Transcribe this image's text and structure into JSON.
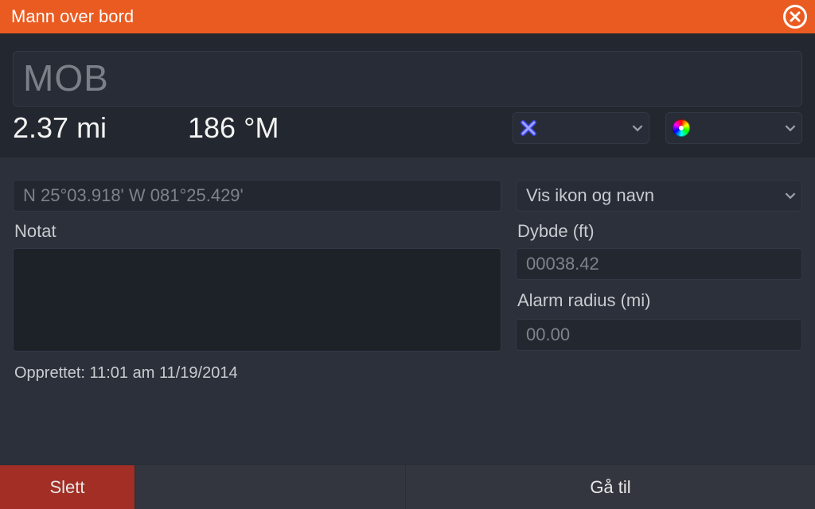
{
  "window": {
    "title": "Mann over bord"
  },
  "top": {
    "name": "MOB",
    "distance": "2.37 mi",
    "bearing": "186 °M",
    "icon_combo": "x-marker-icon",
    "color_combo": "color-wheel-icon"
  },
  "mid": {
    "coords": "N 25°03.918'  W 081°25.429'",
    "display_mode": "Vis ikon og navn",
    "notat_label": "Notat",
    "notat_value": "",
    "depth_label": "Dybde (ft)",
    "depth_value": "00038.42",
    "alarm_label": "Alarm radius (mi)",
    "alarm_value": "00.00",
    "created": "Opprettet: 11:01 am  11/19/2014"
  },
  "buttons": {
    "delete": "Slett",
    "goto": "Gå til"
  }
}
